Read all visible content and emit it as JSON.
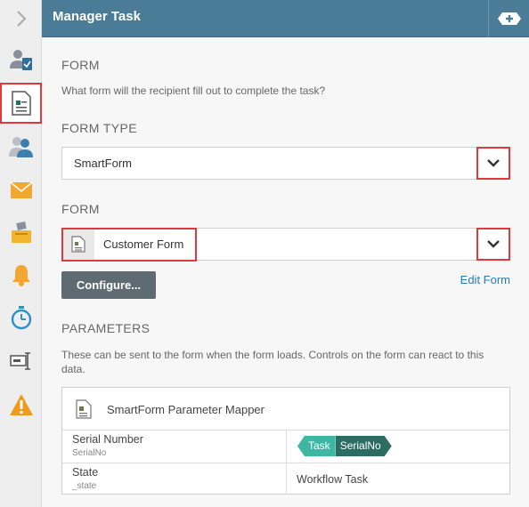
{
  "header": {
    "title": "Manager Task"
  },
  "sidebar": {
    "items": [
      {
        "name": "expand",
        "icon": "chevron-right-icon"
      },
      {
        "name": "task",
        "icon": "user-clipboard-icon"
      },
      {
        "name": "form",
        "icon": "form-icon",
        "selected": true
      },
      {
        "name": "recipients",
        "icon": "users-icon"
      },
      {
        "name": "email",
        "icon": "envelope-icon"
      },
      {
        "name": "actions",
        "icon": "inbox-icon"
      },
      {
        "name": "notifications",
        "icon": "bell-icon"
      },
      {
        "name": "timer",
        "icon": "stopwatch-icon"
      },
      {
        "name": "data",
        "icon": "field-icon"
      },
      {
        "name": "warning",
        "icon": "warning-icon"
      }
    ]
  },
  "form_section": {
    "title": "FORM",
    "help": "What form will the recipient fill out to complete the task?"
  },
  "form_type": {
    "label": "FORM TYPE",
    "value": "SmartForm"
  },
  "form_select": {
    "label": "FORM",
    "value": "Customer Form"
  },
  "buttons": {
    "configure": "Configure...",
    "edit_form": "Edit Form"
  },
  "parameters": {
    "title": "PARAMETERS",
    "help": "These can be sent to the form when the form loads. Controls on the form can react to this data.",
    "mapper_title": "SmartForm Parameter Mapper",
    "rows": [
      {
        "name": "Serial Number",
        "sub": "SerialNo",
        "token": {
          "context": "Task",
          "field": "SerialNo"
        }
      },
      {
        "name": "State",
        "sub": "_state",
        "value": "Workflow Task"
      }
    ]
  },
  "colors": {
    "header": "#4a7c98",
    "highlight": "#e0383e",
    "token_task": "#3fb6a4",
    "token_field": "#2b6d62",
    "link": "#2a7ab8"
  }
}
